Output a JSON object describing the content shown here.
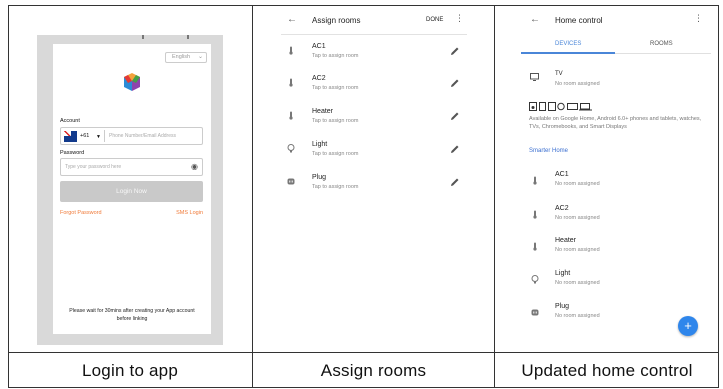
{
  "captions": [
    "Login to app",
    "Assign rooms",
    "Updated home control"
  ],
  "login": {
    "language": "English",
    "account_label": "Account",
    "country_code": "+61",
    "phone_placeholder": "Phone Number/Email Address",
    "password_label": "Password",
    "password_placeholder": "Type your password here",
    "login_button": "Login Now",
    "forgot_password": "Forgot Password",
    "sms_login": "SMS Login",
    "note": "Please wait for 30mins after creating your App account before linking"
  },
  "assign": {
    "title": "Assign rooms",
    "done": "DONE",
    "rows": [
      {
        "name": "AC1",
        "sub": "Tap to assign room",
        "icon": "thermometer-icon"
      },
      {
        "name": "AC2",
        "sub": "Tap to assign room",
        "icon": "thermometer-icon"
      },
      {
        "name": "Heater",
        "sub": "Tap to assign room",
        "icon": "thermometer-icon"
      },
      {
        "name": "Light",
        "sub": "Tap to assign room",
        "icon": "bulb-icon"
      },
      {
        "name": "Plug",
        "sub": "Tap to assign room",
        "icon": "plug-icon"
      }
    ]
  },
  "home": {
    "title": "Home control",
    "tabs": [
      "DEVICES",
      "ROOMS"
    ],
    "tv": {
      "name": "TV",
      "sub": "No room assigned"
    },
    "available_text": "Available on Google Home, Android 6.0+ phones and tablets, watches, TVs, Chromebooks, and Smart Displays",
    "section_link": "Smarter Home",
    "rows": [
      {
        "name": "AC1",
        "sub": "No room assigned"
      },
      {
        "name": "AC2",
        "sub": "No room assigned"
      },
      {
        "name": "Heater",
        "sub": "No room assigned"
      },
      {
        "name": "Light",
        "sub": "No room assigned"
      },
      {
        "name": "Plug",
        "sub": "No room assigned"
      }
    ],
    "fab": "+"
  },
  "colors": {
    "accent_orange": "#f07b3a",
    "accent_blue": "#4a86d8",
    "fab_blue": "#2f86eb"
  }
}
